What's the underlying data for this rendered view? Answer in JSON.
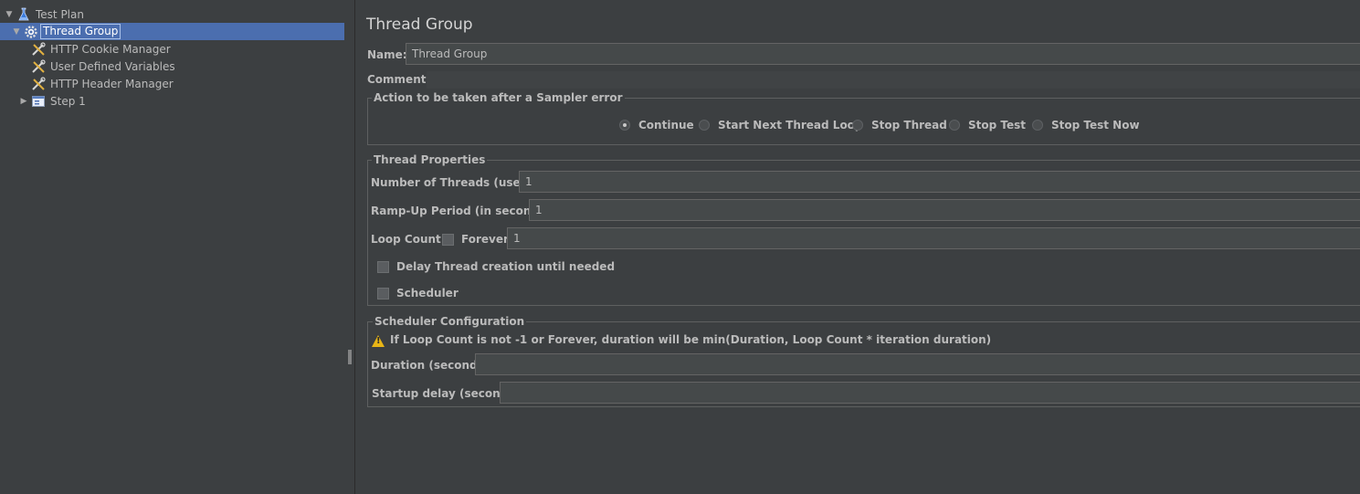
{
  "tree": {
    "items": [
      {
        "label": "Test Plan",
        "icon": "test-plan-icon",
        "expander": "down"
      },
      {
        "label": "Thread Group",
        "icon": "gear-icon",
        "expander": "down",
        "selected": true
      },
      {
        "label": "HTTP Cookie Manager",
        "icon": "wrench-icon"
      },
      {
        "label": "User Defined Variables",
        "icon": "wrench-icon"
      },
      {
        "label": "HTTP Header Manager",
        "icon": "wrench-icon"
      },
      {
        "label": "Step 1",
        "icon": "controller-icon",
        "expander": "right"
      }
    ]
  },
  "panel": {
    "title": "Thread Group",
    "name_label": "Name:",
    "name_value": "Thread Group",
    "comments_label": "Comments:",
    "comments_value": ""
  },
  "sampler_error": {
    "title": "Action to be taken after a Sampler error",
    "options": [
      "Continue",
      "Start Next Thread Loop",
      "Stop Thread",
      "Stop Test",
      "Stop Test Now"
    ],
    "selected": "Continue"
  },
  "thread_properties": {
    "title": "Thread Properties",
    "threads_label": "Number of Threads (users):",
    "threads_value": "1",
    "rampup_label": "Ramp-Up Period (in seconds):",
    "rampup_value": "1",
    "loop_label": "Loop Count:",
    "forever_label": "Forever",
    "forever_checked": false,
    "loop_value": "1",
    "delay_label": "Delay Thread creation until needed",
    "delay_checked": false,
    "scheduler_label": "Scheduler",
    "scheduler_checked": false
  },
  "scheduler_config": {
    "title": "Scheduler Configuration",
    "warning": "If Loop Count is not -1 or Forever, duration will be min(Duration, Loop Count * iteration duration)",
    "duration_label": "Duration (seconds)",
    "duration_value": "",
    "startup_label": "Startup delay (seconds)",
    "startup_value": ""
  },
  "colors": {
    "background": "#3c3f41",
    "selection": "#4b6eaf",
    "field": "#45494a",
    "warning": "#e8b516"
  }
}
